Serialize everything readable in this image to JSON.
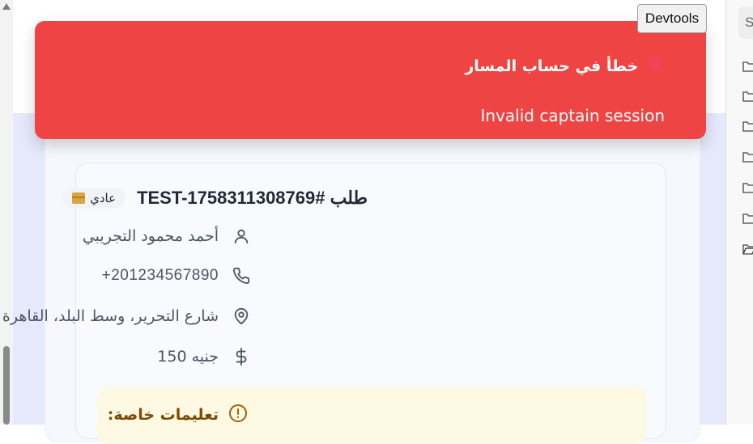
{
  "toast": {
    "title": "خطأ في حساب المسار",
    "message": "Invalid captain session",
    "close_icon": "x-icon"
  },
  "devtools": {
    "label": "Devtools"
  },
  "order": {
    "title": "طلب #TEST-1758311308769",
    "type_badge": "عادي",
    "customer_name": "أحمد محمود التجريبي",
    "phone": "+201234567890",
    "address": "شارع التحرير، وسط البلد، القاهرة",
    "amount": "جنيه 150",
    "special_instructions_title": "تعليمات خاصة:"
  },
  "right_panel": {
    "search_placeholder": "S"
  },
  "colors": {
    "toast_bg": "#ef4444",
    "page_bg": "#e5e9fb",
    "card_bg": "#f9fafd",
    "special_bg": "#fef9e3"
  },
  "icons": [
    "user-icon",
    "phone-icon",
    "map-pin-icon",
    "dollar-icon",
    "alert-circle-icon",
    "package-icon",
    "folder-icon"
  ]
}
